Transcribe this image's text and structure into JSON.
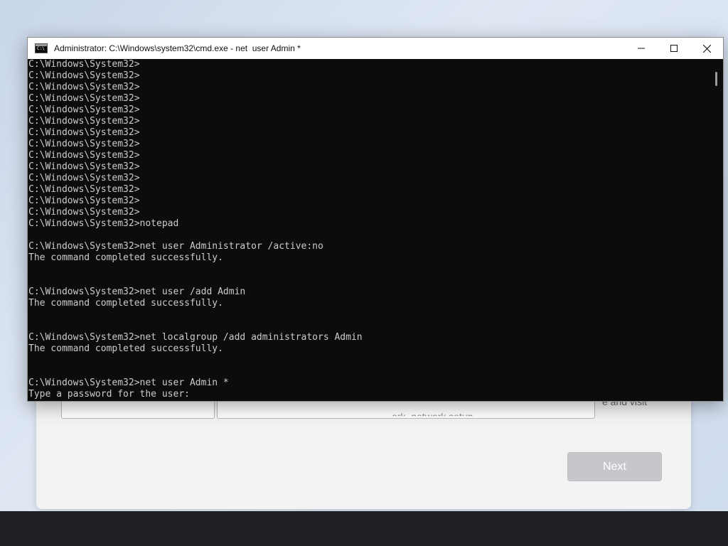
{
  "cmd_window": {
    "title": "Administrator: C:\\Windows\\system32\\cmd.exe - net  user Admin *",
    "icon": "cmd-icon",
    "icon_label": "C:\\",
    "controls": {
      "minimize": "minimize-icon",
      "maximize": "maximize-icon",
      "close": "close-icon"
    },
    "lines": [
      "C:\\Windows\\System32>",
      "C:\\Windows\\System32>",
      "C:\\Windows\\System32>",
      "C:\\Windows\\System32>",
      "C:\\Windows\\System32>",
      "C:\\Windows\\System32>",
      "C:\\Windows\\System32>",
      "C:\\Windows\\System32>",
      "C:\\Windows\\System32>",
      "C:\\Windows\\System32>",
      "C:\\Windows\\System32>",
      "C:\\Windows\\System32>",
      "C:\\Windows\\System32>",
      "C:\\Windows\\System32>",
      "C:\\Windows\\System32>notepad",
      "",
      "C:\\Windows\\System32>net user Administrator /active:no",
      "The command completed successfully.",
      "",
      "",
      "C:\\Windows\\System32>net user /add Admin",
      "The command completed successfully.",
      "",
      "",
      "C:\\Windows\\System32>net localgroup /add administrators Admin",
      "The command completed successfully.",
      "",
      "",
      "C:\\Windows\\System32>net user Admin *",
      "Type a password for the user:"
    ]
  },
  "oobe": {
    "partial_text_1": "e and visit",
    "partial_text_2": "ork, network setup",
    "next_button": "Next"
  },
  "colors": {
    "console_bg": "#0c0c0c",
    "console_fg": "#cccccc",
    "taskbar_bg": "#202124",
    "next_disabled_bg": "#c5c7cb"
  }
}
